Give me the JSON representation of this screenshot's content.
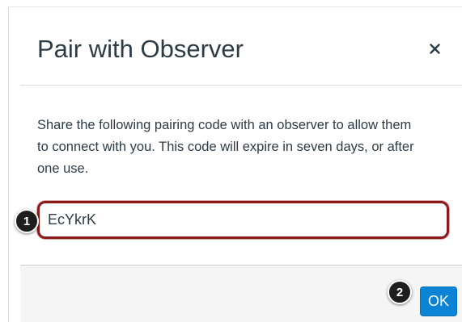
{
  "dialog": {
    "title": "Pair with Observer",
    "close_label": "Close",
    "description": "Share the following pairing code with an observer to allow them to connect with you. This code will expire in seven days, or after one use.",
    "pairing_code": "EcYkrK",
    "ok_label": "OK"
  },
  "callouts": [
    "1",
    "2"
  ],
  "colors": {
    "title_text": "#2d3b45",
    "highlight_border": "#8b1a1a",
    "ok_button": "#0b84d6",
    "footer_background": "#f5f5f5"
  },
  "icons": {
    "close": "close-icon"
  }
}
